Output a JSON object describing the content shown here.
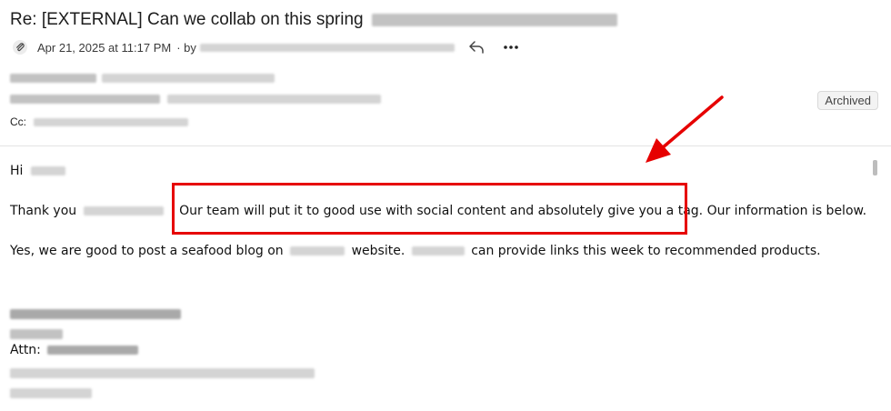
{
  "email": {
    "subject": "Re: [EXTERNAL] Can we collab on this spring",
    "date": "Apr 21, 2025 at 11:17 PM",
    "by_prefix": "· by",
    "status_badge": "Archived",
    "cc_label": "Cc:",
    "body": {
      "greeting": "Hi",
      "thanks_start": "Thank you",
      "thanks_bang": "!",
      "highlighted": "Our team will put it to good use with social content and absolutely give you a tag.",
      "thanks_end": "Our information is below.",
      "p2_start": "Yes, we are good to post a seafood blog on",
      "p2_mid": "website.",
      "p2_end": "can provide links this week to recommended products.",
      "attn_label": "Attn:"
    }
  },
  "icons": {
    "attachment": "paperclip-icon",
    "reply": "reply-icon",
    "more": "more-horizontal-icon",
    "annotation_arrow": "red-arrow-annotation"
  },
  "colors": {
    "highlight": "#e60000",
    "badge_bg": "#f3f3f3"
  }
}
